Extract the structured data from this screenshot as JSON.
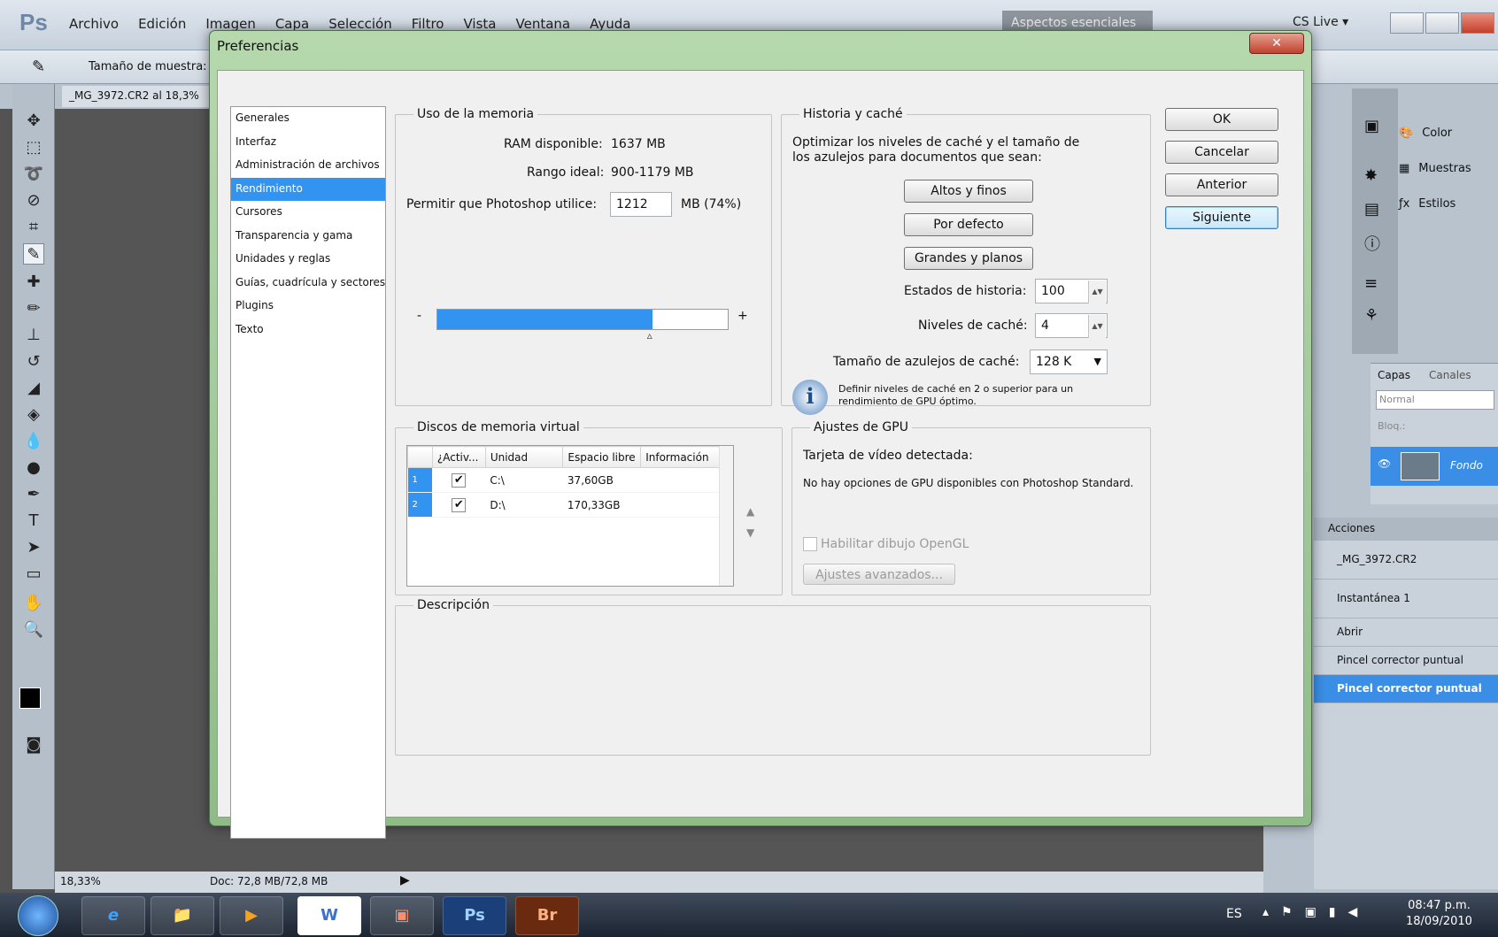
{
  "app": {
    "logo": "Ps",
    "menu": [
      "Archivo",
      "Edición",
      "Imagen",
      "Capa",
      "Selección",
      "Filtro",
      "Vista",
      "Ventana",
      "Ayuda"
    ],
    "workspace": "Aspectos esenciales",
    "cs_live": "CS Live ▾",
    "options_label": "Tamaño de muestra:",
    "doc_tab": "_MG_3972.CR2 al 18,3%",
    "zoom": "18,33%",
    "doc_info": "Doc: 72,8 MB/72,8 MB"
  },
  "right_panel": {
    "items": [
      "Color",
      "Muestras",
      "Estilos"
    ],
    "layers_tabs": [
      "Capas",
      "Canales"
    ],
    "blend_mode": "Normal",
    "lock_label": "Bloq.:",
    "layer_name": "Fondo",
    "actions_tab": "Acciones",
    "history": [
      "_MG_3972.CR2",
      "Instantánea 1",
      "Abrir",
      "Pincel corrector puntual",
      "Pincel corrector puntual"
    ]
  },
  "dialog": {
    "title": "Preferencias",
    "close": "✕",
    "categories": [
      "Generales",
      "Interfaz",
      "Administración de archivos",
      "Rendimiento",
      "Cursores",
      "Transparencia y gama",
      "Unidades y reglas",
      "Guías, cuadrícula y sectores",
      "Plugins",
      "Texto"
    ],
    "selected_category": "Rendimiento",
    "buttons": {
      "ok": "OK",
      "cancel": "Cancelar",
      "prev": "Anterior",
      "next": "Siguiente"
    },
    "memory": {
      "legend": "Uso de la memoria",
      "ram_label": "RAM disponible:",
      "ram_value": "1637 MB",
      "ideal_label": "Rango ideal:",
      "ideal_value": "900-1179 MB",
      "allow_label": "Permitir que Photoshop utilice:",
      "allow_value": "1212",
      "allow_unit": "MB (74%)",
      "slider_fraction": 0.74,
      "minus": "-",
      "plus": "+"
    },
    "history": {
      "legend": "Historia y caché",
      "text": "Optimizar los niveles de caché y el tamaño de los azulejos para documentos que sean:",
      "btn_tall": "Altos y finos",
      "btn_default": "Por defecto",
      "btn_big": "Grandes y planos",
      "states_label": "Estados de historia:",
      "states_value": "100",
      "levels_label": "Niveles de caché:",
      "levels_value": "4",
      "tile_label": "Tamaño de azulejos de caché:",
      "tile_value": "128 K",
      "info_text": "Definir niveles de caché en 2 o superior para un rendimiento de GPU óptimo."
    },
    "scratch": {
      "legend": "Discos de memoria virtual",
      "columns": [
        "¿Activ...",
        "Unidad",
        "Espacio libre",
        "Información"
      ],
      "rows": [
        {
          "n": "1",
          "active": "✔",
          "drive": "C:\\",
          "free": "37,60GB",
          "info": ""
        },
        {
          "n": "2",
          "active": "✔",
          "drive": "D:\\",
          "free": "170,33GB",
          "info": ""
        }
      ]
    },
    "gpu": {
      "legend": "Ajustes de GPU",
      "card_label": "Tarjeta de vídeo detectada:",
      "message": "No hay opciones de GPU disponibles con Photoshop Standard.",
      "opengl": "Habilitar dibujo OpenGL",
      "advanced": "Ajustes avanzados..."
    },
    "description": {
      "legend": "Descripción"
    }
  },
  "taskbar": {
    "apps": [
      "e",
      "📁",
      "▶",
      "W",
      "▣",
      "Ps",
      "Br"
    ],
    "lang": "ES",
    "time": "08:47 p.m.",
    "date": "18/09/2010"
  }
}
